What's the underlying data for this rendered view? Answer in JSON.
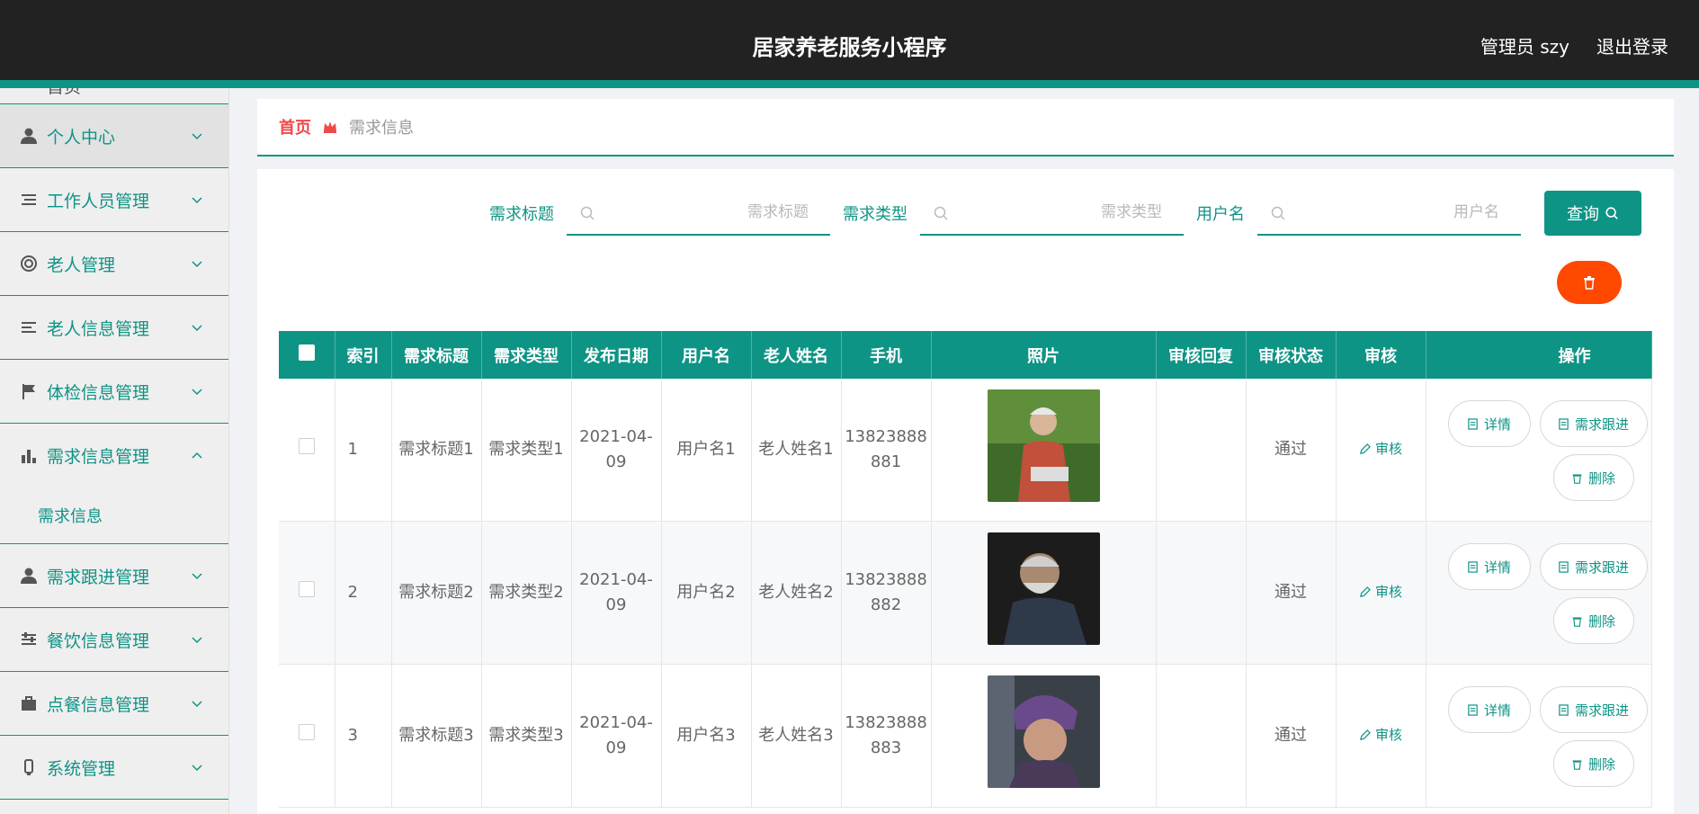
{
  "header": {
    "title": "居家养老服务小程序",
    "admin_label": "管理员 szy",
    "logout_label": "退出登录"
  },
  "sidebar": {
    "partial_top_label": "首页",
    "items": [
      {
        "label": "个人中心",
        "icon": "user-icon"
      },
      {
        "label": "工作人员管理",
        "icon": "list-icon"
      },
      {
        "label": "老人管理",
        "icon": "lifebuoy-icon"
      },
      {
        "label": "老人信息管理",
        "icon": "list-icon"
      },
      {
        "label": "体检信息管理",
        "icon": "flag-icon"
      },
      {
        "label": "需求信息管理",
        "icon": "bar-chart-icon",
        "expanded": true
      },
      {
        "label": "需求跟进管理",
        "icon": "user-icon"
      },
      {
        "label": "餐饮信息管理",
        "icon": "sliders-icon"
      },
      {
        "label": "点餐信息管理",
        "icon": "briefcase-icon"
      },
      {
        "label": "系统管理",
        "icon": "system-icon"
      }
    ],
    "submenu_label": "需求信息"
  },
  "breadcrumb": {
    "home": "首页",
    "current": "需求信息"
  },
  "search": {
    "fields": [
      {
        "label": "需求标题",
        "placeholder": "需求标题"
      },
      {
        "label": "需求类型",
        "placeholder": "需求类型"
      },
      {
        "label": "用户名",
        "placeholder": "用户名"
      }
    ],
    "query_label": "查询"
  },
  "table": {
    "columns": [
      "索引",
      "需求标题",
      "需求类型",
      "发布日期",
      "用户名",
      "老人姓名",
      "手机",
      "照片",
      "审核回复",
      "审核状态",
      "审核",
      "操作"
    ],
    "rows": [
      {
        "index": "1",
        "title": "需求标题1",
        "type": "需求类型1",
        "date": "2021-04-09",
        "user": "用户名1",
        "elder": "老人姓名1",
        "phone": "13823888881",
        "reply": "",
        "status": "通过",
        "audit": "审核"
      },
      {
        "index": "2",
        "title": "需求标题2",
        "type": "需求类型2",
        "date": "2021-04-09",
        "user": "用户名2",
        "elder": "老人姓名2",
        "phone": "13823888882",
        "reply": "",
        "status": "通过",
        "audit": "审核"
      },
      {
        "index": "3",
        "title": "需求标题3",
        "type": "需求类型3",
        "date": "2021-04-09",
        "user": "用户名3",
        "elder": "老人姓名3",
        "phone": "13823888883",
        "reply": "",
        "status": "通过",
        "audit": "审核"
      }
    ],
    "ops": {
      "detail": "详情",
      "follow": "需求跟进",
      "delete": "删除"
    }
  },
  "colors": {
    "accent": "#0e9485",
    "header_bg": "#222222",
    "danger": "#ff4800",
    "breadcrumb_home": "#f04848"
  }
}
